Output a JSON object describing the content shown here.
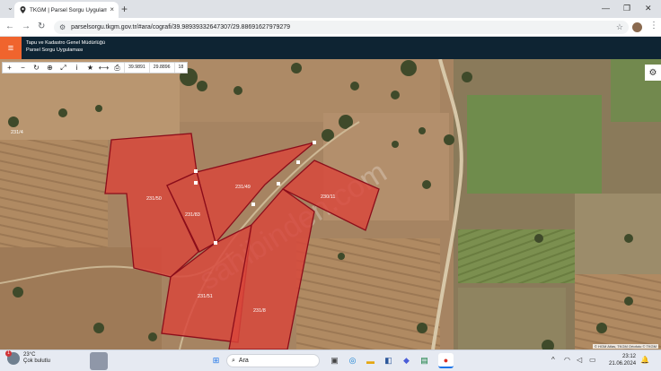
{
  "browser": {
    "tab_title": "TKGM | Parsel Sorgu Uygulama...",
    "url": "parselsorgu.tkgm.gov.tr/#ara/cografi/39.98939332647307/29.88691627979279",
    "new_tab": "+",
    "minimize": "—",
    "maximize": "❐",
    "close": "✕"
  },
  "app": {
    "title_line1": "Tapu ve Kadastro Genel Müdürlüğü",
    "title_line2": "Parsel Sorgu Uygulaması"
  },
  "toolbar": {
    "lat": "39.9891",
    "lon": "29.8896",
    "zoom": "18"
  },
  "map": {
    "watermark": "sahibinden.com",
    "attribution": "© HGM Atlas, TKGM Ortofoto © TKGM",
    "parcels": [
      "231/50",
      "231/49",
      "230/11",
      "231/83",
      "231/51",
      "231/8",
      "231/4"
    ],
    "parcel_color": "#d9453a",
    "parcel_stroke": "#8b0d1a"
  },
  "taskbar": {
    "temperature": "23°C",
    "weather": "Çok bulutlu",
    "weather_badge": "1",
    "search": "Ara",
    "time": "23:12",
    "date": "21.06.2024"
  }
}
